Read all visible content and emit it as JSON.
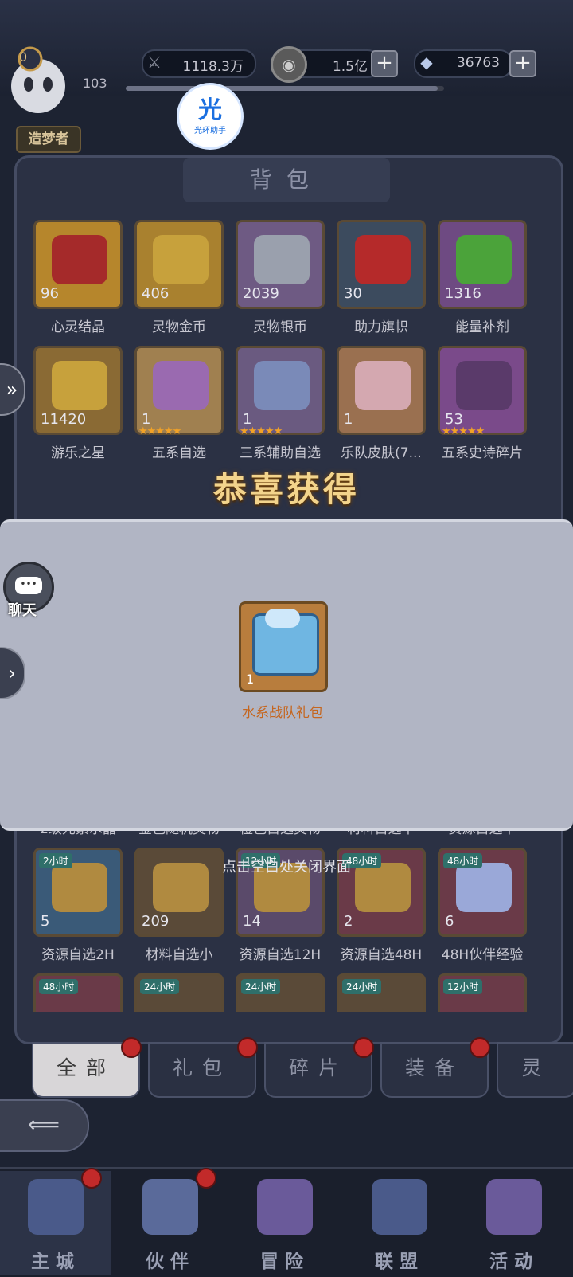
{
  "header": {
    "power": "1118.3万",
    "gold": "1.5亿",
    "gems": "36763",
    "level": "103",
    "rank_badge": "造梦者",
    "helper_glyph": "光",
    "helper_text": "光环助手"
  },
  "backpack": {
    "title": "背包",
    "row1": [
      {
        "name": "心灵结晶",
        "count": "96",
        "color": "#b6862c",
        "pic": "#a52a2a"
      },
      {
        "name": "灵物金币",
        "count": "406",
        "color": "#a9812f",
        "pic": "#c7a13c"
      },
      {
        "name": "灵物银币",
        "count": "2039",
        "color": "#6e5a83",
        "pic": "#9aa0ad"
      },
      {
        "name": "助力旗帜",
        "count": "30",
        "color": "#3c4b5e",
        "pic": "#b52a2a"
      },
      {
        "name": "能量补剂",
        "count": "1316",
        "color": "#6e4a82",
        "pic": "#4ba33a"
      }
    ],
    "row2": [
      {
        "name": "游乐之星",
        "count": "11420",
        "color": "#8a6a34",
        "pic": "#c7a13c",
        "stars": ""
      },
      {
        "name": "五系自选",
        "count": "1",
        "color": "#a08050",
        "pic": "#9a6ab0",
        "stars": "★★★★★"
      },
      {
        "name": "三系辅助自选",
        "count": "1",
        "color": "#6a5a80",
        "pic": "#7a8ab8",
        "stars": "★★★★★"
      },
      {
        "name": "乐队皮肤(7...",
        "count": "1",
        "color": "#9a7050",
        "pic": "#d4a8b0",
        "stars": ""
      },
      {
        "name": "五系史诗碎片",
        "count": "53",
        "color": "#7a4a8a",
        "pic": "#5a3a6a",
        "stars": "★★★★★"
      }
    ],
    "row3_labels": [
      "2级元素水晶",
      "金色随机灵物",
      "橙色自选灵物",
      "材料自选中",
      "资源自选中"
    ],
    "row4": [
      {
        "name": "资源自选2H",
        "count": "5",
        "color": "#3a5a78",
        "pic": "#b08a40",
        "tag": "2小时"
      },
      {
        "name": "材料自选小",
        "count": "209",
        "color": "#5a4a38",
        "pic": "#b08a40",
        "tag": ""
      },
      {
        "name": "资源自选12H",
        "count": "14",
        "color": "#5a4a6a",
        "pic": "#b08a40",
        "tag": "12小时"
      },
      {
        "name": "资源自选48H",
        "count": "2",
        "color": "#6a3a48",
        "pic": "#b08a40",
        "tag": "48小时"
      },
      {
        "name": "48H伙伴经验",
        "count": "6",
        "color": "#6a3a48",
        "pic": "#9aa8d8",
        "tag": "48小时"
      }
    ],
    "row5_tags": [
      "48小时",
      "24小时",
      "24小时",
      "24小时",
      "12小时"
    ]
  },
  "reward": {
    "title": "恭喜获得",
    "item_name": "水系战队礼包",
    "item_count": "1",
    "close_hint": "点击空白处关闭界面"
  },
  "side": {
    "chat_label": "聊天",
    "chat_bubble": "•••"
  },
  "tabs": [
    "全部",
    "礼包",
    "碎片",
    "装备",
    "灵"
  ],
  "nav": [
    "主城",
    "伙伴",
    "冒险",
    "联盟",
    "活动"
  ]
}
